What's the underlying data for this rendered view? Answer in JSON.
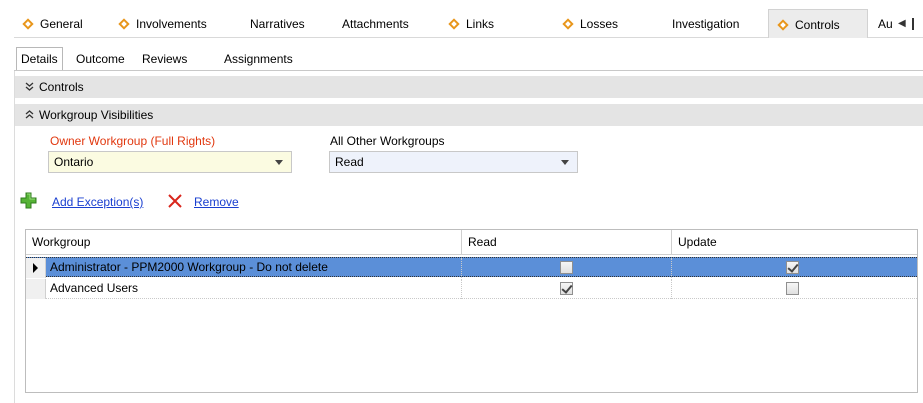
{
  "tabs": [
    {
      "label": "General",
      "icon": "diamond-icon"
    },
    {
      "label": "Involvements",
      "icon": "diamond-icon"
    },
    {
      "label": "Narratives",
      "icon": ""
    },
    {
      "label": "Attachments",
      "icon": ""
    },
    {
      "label": "Links",
      "icon": "diamond-icon"
    },
    {
      "label": "Losses",
      "icon": "diamond-icon"
    },
    {
      "label": "Investigation",
      "icon": ""
    },
    {
      "label": "Controls",
      "icon": "diamond-icon",
      "active": true
    },
    {
      "label": "Au",
      "icon": ""
    }
  ],
  "tab_scroll_left": "◀",
  "subtabs": [
    {
      "label": "Details",
      "active": true
    },
    {
      "label": "Outcome"
    },
    {
      "label": "Reviews"
    },
    {
      "label": "Assignments"
    }
  ],
  "sections": {
    "controls": {
      "label": "Controls",
      "state": "collapsed",
      "chevron": "≽"
    },
    "workgroup_visibilities": {
      "label": "Workgroup Visibilities",
      "state": "expanded",
      "chevron": "≼"
    }
  },
  "owner_workgroup": {
    "label": "Owner Workgroup (Full Rights)",
    "value": "Ontario"
  },
  "other_workgroups": {
    "label": "All Other Workgroups",
    "value": "Read"
  },
  "actions": {
    "add_label": "Add Exception(s)",
    "remove_label": "Remove"
  },
  "grid": {
    "columns": [
      "Workgroup",
      "Read",
      "Update"
    ],
    "rows": [
      {
        "workgroup": "Administrator - PPM2000 Workgroup - Do not delete",
        "read": false,
        "update": true,
        "selected": true
      },
      {
        "workgroup": "Advanced Users",
        "read": true,
        "update": false,
        "selected": false
      }
    ]
  },
  "colors": {
    "accent_orange": "#e8961b",
    "owner_label_red": "#e1380f",
    "link_blue": "#1a3fd0",
    "selected_row": "#5b8fd8",
    "section_header_bg": "#e4e4e4"
  }
}
